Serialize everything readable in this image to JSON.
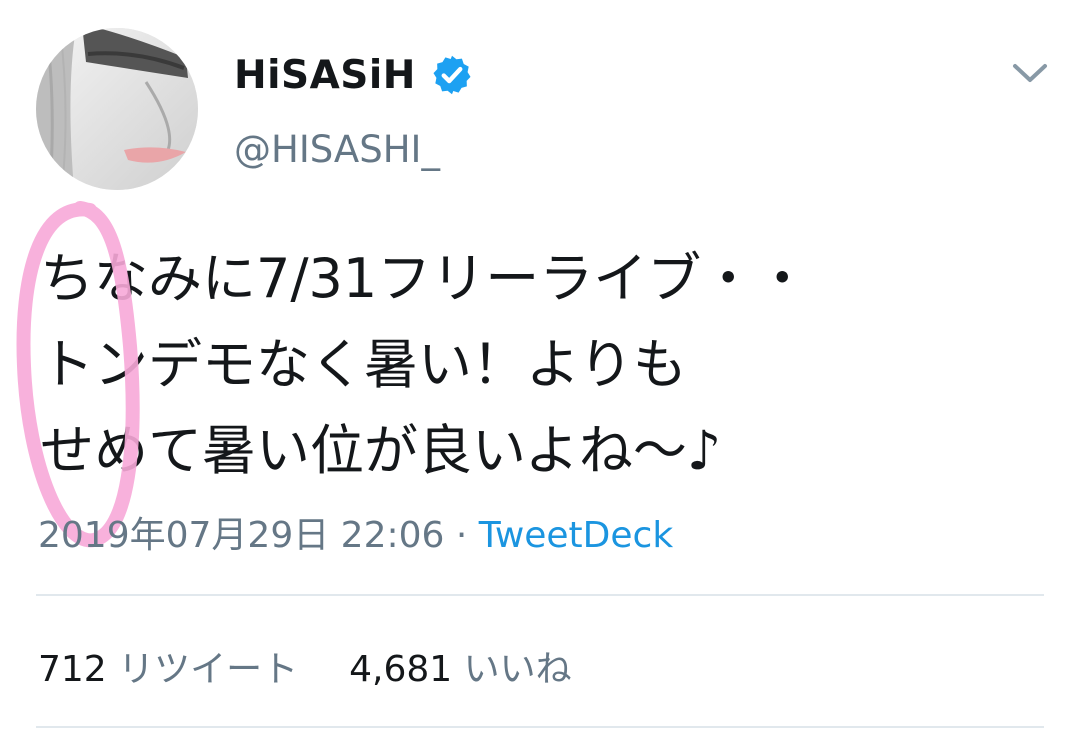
{
  "user": {
    "display_name": "HiSASiH",
    "handle": "@HISASHI_",
    "verified": true
  },
  "tweet": {
    "lines": [
      "ちなみに7/31フリーライブ・・",
      "トンデモなく暑い！よりも",
      "せめて暑い位が良いよね〜♪"
    ],
    "timestamp": "2019年07月29日 22:06",
    "separator": " · ",
    "source": "TweetDeck"
  },
  "stats": {
    "retweets_count": "712",
    "retweets_label": "リツイート",
    "likes_count": "4,681",
    "likes_label": "いいね"
  },
  "icons": {
    "verified": "verified-badge-icon",
    "menu": "chevron-down-icon"
  },
  "colors": {
    "text": "#14171a",
    "secondary": "#657786",
    "link": "#1b95e0",
    "verified": "#1da1f2",
    "annotation": "#f7a8d8"
  }
}
